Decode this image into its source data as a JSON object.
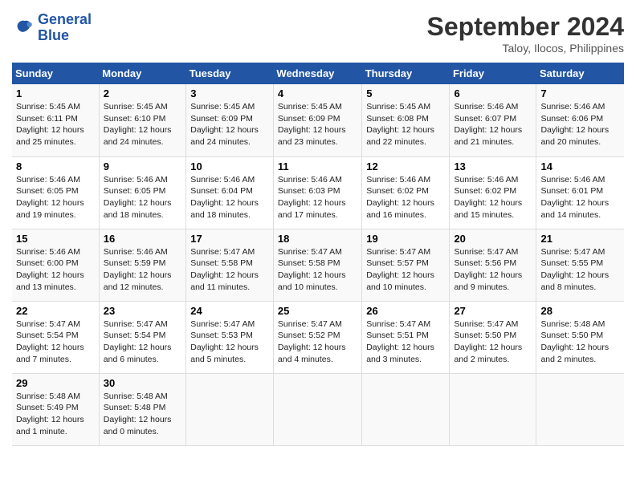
{
  "logo": {
    "line1": "General",
    "line2": "Blue"
  },
  "title": "September 2024",
  "location": "Taloy, Ilocos, Philippines",
  "headers": [
    "Sunday",
    "Monday",
    "Tuesday",
    "Wednesday",
    "Thursday",
    "Friday",
    "Saturday"
  ],
  "weeks": [
    [
      {
        "day": "1",
        "sunrise": "5:45 AM",
        "sunset": "6:11 PM",
        "daylight": "12 hours and 25 minutes."
      },
      {
        "day": "2",
        "sunrise": "5:45 AM",
        "sunset": "6:10 PM",
        "daylight": "12 hours and 24 minutes."
      },
      {
        "day": "3",
        "sunrise": "5:45 AM",
        "sunset": "6:09 PM",
        "daylight": "12 hours and 24 minutes."
      },
      {
        "day": "4",
        "sunrise": "5:45 AM",
        "sunset": "6:09 PM",
        "daylight": "12 hours and 23 minutes."
      },
      {
        "day": "5",
        "sunrise": "5:45 AM",
        "sunset": "6:08 PM",
        "daylight": "12 hours and 22 minutes."
      },
      {
        "day": "6",
        "sunrise": "5:46 AM",
        "sunset": "6:07 PM",
        "daylight": "12 hours and 21 minutes."
      },
      {
        "day": "7",
        "sunrise": "5:46 AM",
        "sunset": "6:06 PM",
        "daylight": "12 hours and 20 minutes."
      }
    ],
    [
      {
        "day": "8",
        "sunrise": "5:46 AM",
        "sunset": "6:05 PM",
        "daylight": "12 hours and 19 minutes."
      },
      {
        "day": "9",
        "sunrise": "5:46 AM",
        "sunset": "6:05 PM",
        "daylight": "12 hours and 18 minutes."
      },
      {
        "day": "10",
        "sunrise": "5:46 AM",
        "sunset": "6:04 PM",
        "daylight": "12 hours and 18 minutes."
      },
      {
        "day": "11",
        "sunrise": "5:46 AM",
        "sunset": "6:03 PM",
        "daylight": "12 hours and 17 minutes."
      },
      {
        "day": "12",
        "sunrise": "5:46 AM",
        "sunset": "6:02 PM",
        "daylight": "12 hours and 16 minutes."
      },
      {
        "day": "13",
        "sunrise": "5:46 AM",
        "sunset": "6:02 PM",
        "daylight": "12 hours and 15 minutes."
      },
      {
        "day": "14",
        "sunrise": "5:46 AM",
        "sunset": "6:01 PM",
        "daylight": "12 hours and 14 minutes."
      }
    ],
    [
      {
        "day": "15",
        "sunrise": "5:46 AM",
        "sunset": "6:00 PM",
        "daylight": "12 hours and 13 minutes."
      },
      {
        "day": "16",
        "sunrise": "5:46 AM",
        "sunset": "5:59 PM",
        "daylight": "12 hours and 12 minutes."
      },
      {
        "day": "17",
        "sunrise": "5:47 AM",
        "sunset": "5:58 PM",
        "daylight": "12 hours and 11 minutes."
      },
      {
        "day": "18",
        "sunrise": "5:47 AM",
        "sunset": "5:58 PM",
        "daylight": "12 hours and 10 minutes."
      },
      {
        "day": "19",
        "sunrise": "5:47 AM",
        "sunset": "5:57 PM",
        "daylight": "12 hours and 10 minutes."
      },
      {
        "day": "20",
        "sunrise": "5:47 AM",
        "sunset": "5:56 PM",
        "daylight": "12 hours and 9 minutes."
      },
      {
        "day": "21",
        "sunrise": "5:47 AM",
        "sunset": "5:55 PM",
        "daylight": "12 hours and 8 minutes."
      }
    ],
    [
      {
        "day": "22",
        "sunrise": "5:47 AM",
        "sunset": "5:54 PM",
        "daylight": "12 hours and 7 minutes."
      },
      {
        "day": "23",
        "sunrise": "5:47 AM",
        "sunset": "5:54 PM",
        "daylight": "12 hours and 6 minutes."
      },
      {
        "day": "24",
        "sunrise": "5:47 AM",
        "sunset": "5:53 PM",
        "daylight": "12 hours and 5 minutes."
      },
      {
        "day": "25",
        "sunrise": "5:47 AM",
        "sunset": "5:52 PM",
        "daylight": "12 hours and 4 minutes."
      },
      {
        "day": "26",
        "sunrise": "5:47 AM",
        "sunset": "5:51 PM",
        "daylight": "12 hours and 3 minutes."
      },
      {
        "day": "27",
        "sunrise": "5:47 AM",
        "sunset": "5:50 PM",
        "daylight": "12 hours and 2 minutes."
      },
      {
        "day": "28",
        "sunrise": "5:48 AM",
        "sunset": "5:50 PM",
        "daylight": "12 hours and 2 minutes."
      }
    ],
    [
      {
        "day": "29",
        "sunrise": "5:48 AM",
        "sunset": "5:49 PM",
        "daylight": "12 hours and 1 minute."
      },
      {
        "day": "30",
        "sunrise": "5:48 AM",
        "sunset": "5:48 PM",
        "daylight": "12 hours and 0 minutes."
      },
      {
        "day": "",
        "sunrise": "",
        "sunset": "",
        "daylight": ""
      },
      {
        "day": "",
        "sunrise": "",
        "sunset": "",
        "daylight": ""
      },
      {
        "day": "",
        "sunrise": "",
        "sunset": "",
        "daylight": ""
      },
      {
        "day": "",
        "sunrise": "",
        "sunset": "",
        "daylight": ""
      },
      {
        "day": "",
        "sunrise": "",
        "sunset": "",
        "daylight": ""
      }
    ]
  ]
}
